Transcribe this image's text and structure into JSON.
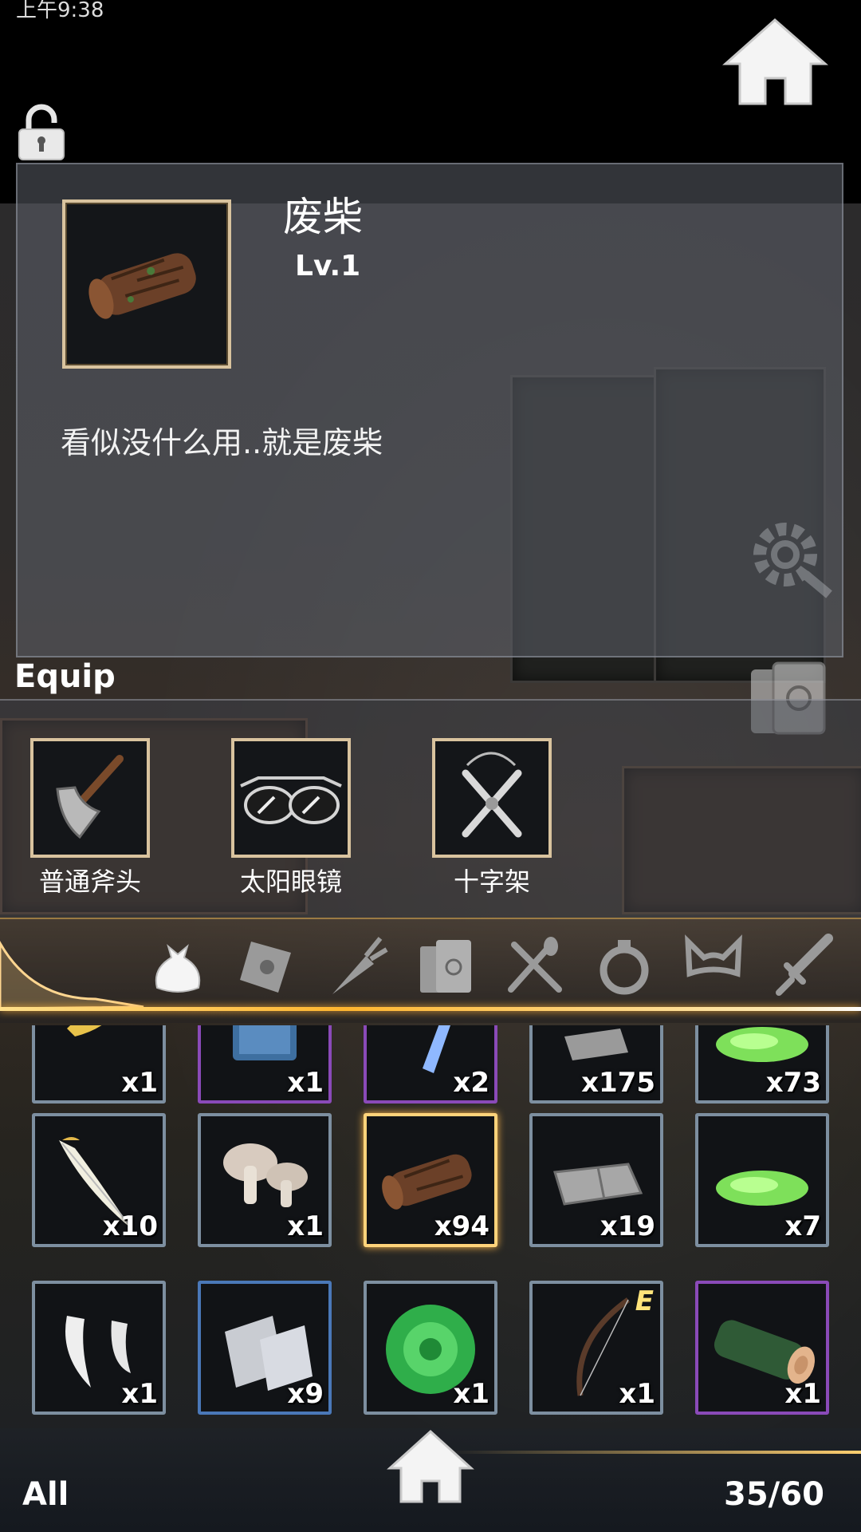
{
  "status_bar": {
    "time": "上午9:38"
  },
  "detail": {
    "name": "废柴",
    "level": "Lv.1",
    "description": "看似没什么用..就是废柴"
  },
  "equip": {
    "title": "Equip",
    "slots": [
      {
        "label": "普通斧头",
        "icon": "axe-icon"
      },
      {
        "label": "太阳眼镜",
        "icon": "sunglasses-icon"
      },
      {
        "label": "十字架",
        "icon": "cross-icon"
      }
    ]
  },
  "tabs": [
    "bag-icon",
    "letter-icon",
    "carrot-icon",
    "book-icon",
    "utensils-icon",
    "ring-icon",
    "cat-ears-icon",
    "sword-icon"
  ],
  "inventory": {
    "rows": [
      [
        {
          "icon": "leaf-icon",
          "qty": "x1",
          "rarity": "normal"
        },
        {
          "icon": "book-icon",
          "qty": "x1",
          "rarity": "purple"
        },
        {
          "icon": "crystal-icon",
          "qty": "x2",
          "rarity": "purple"
        },
        {
          "icon": "stone-icon",
          "qty": "x175",
          "rarity": "normal"
        },
        {
          "icon": "slime-icon",
          "qty": "x73",
          "rarity": "normal"
        }
      ],
      [
        {
          "icon": "feather-icon",
          "qty": "x10",
          "rarity": "normal"
        },
        {
          "icon": "mushroom-icon",
          "qty": "x1",
          "rarity": "normal"
        },
        {
          "icon": "firewood-icon",
          "qty": "x94",
          "rarity": "selected"
        },
        {
          "icon": "stone-slab-icon",
          "qty": "x19",
          "rarity": "normal"
        },
        {
          "icon": "slime-icon",
          "qty": "x7",
          "rarity": "normal"
        }
      ],
      [
        {
          "icon": "fang-icon",
          "qty": "x1",
          "rarity": "normal"
        },
        {
          "icon": "metal-plate-icon",
          "qty": "x9",
          "rarity": "blue"
        },
        {
          "icon": "cabbage-icon",
          "qty": "x1",
          "rarity": "normal"
        },
        {
          "icon": "bow-icon",
          "qty": "x1",
          "rarity": "normal",
          "badge": "E"
        },
        {
          "icon": "log-icon",
          "qty": "x1",
          "rarity": "purple"
        }
      ]
    ]
  },
  "footer": {
    "filter": "All",
    "count": "35/60"
  }
}
